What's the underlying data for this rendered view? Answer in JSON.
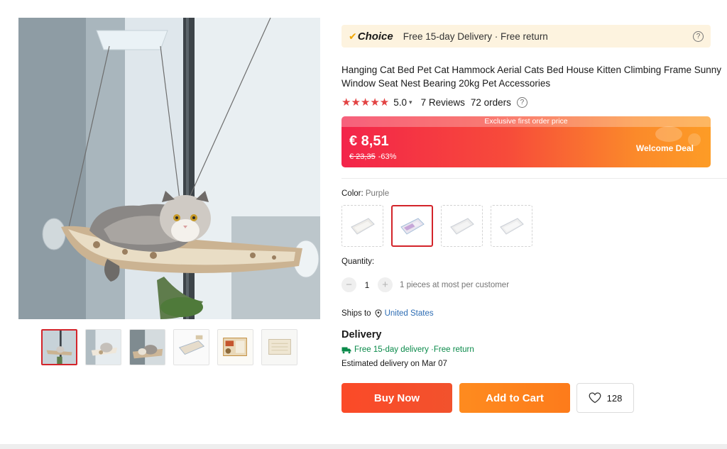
{
  "choice_bar": {
    "logo_text": "Choice",
    "text": "Free 15-day Delivery · Free return",
    "help_glyph": "?"
  },
  "product": {
    "title": "Hanging Cat Bed Pet Cat Hammock Aerial Cats Bed House Kitten Climbing Frame Sunny Window Seat Nest Bearing 20kg Pet Accessories",
    "stars": "★★★★★",
    "rating": "5.0",
    "reviews": "7 Reviews",
    "orders": "72 orders"
  },
  "price": {
    "banner_label": "Exclusive first order price",
    "current": "€ 8,51",
    "original": "€ 23,35",
    "discount": "-63%",
    "deal_label": "Welcome Deal"
  },
  "color": {
    "label": "Color:",
    "selected": "Purple",
    "swatch_count": 4,
    "selected_index": 1
  },
  "quantity": {
    "label": "Quantity:",
    "minus": "−",
    "plus": "+",
    "value": "1",
    "note": "1 pieces at most per customer"
  },
  "shipping": {
    "label": "Ships to",
    "country": "United States"
  },
  "delivery": {
    "heading": "Delivery",
    "free_text": "Free 15-day delivery ·Free return",
    "estimate": "Estimated delivery on Mar 07"
  },
  "actions": {
    "buy_now": "Buy Now",
    "add_to_cart": "Add to Cart",
    "wishlist_count": "128"
  },
  "colors": {
    "accent_red": "#d3242a",
    "buy_now": "#f94c29",
    "add_to_cart": "#fd841d",
    "star": "#e24343",
    "link_blue": "#2e6db4",
    "delivery_green": "#0a8a4a",
    "choice_bg": "#fdf3df"
  },
  "icons": {
    "choice": "check-icon",
    "help": "question-circle-icon",
    "ships": "location-pin-icon",
    "delivery": "truck-icon",
    "wishlist": "heart-icon",
    "rating_dropdown": "chevron-down-icon"
  }
}
